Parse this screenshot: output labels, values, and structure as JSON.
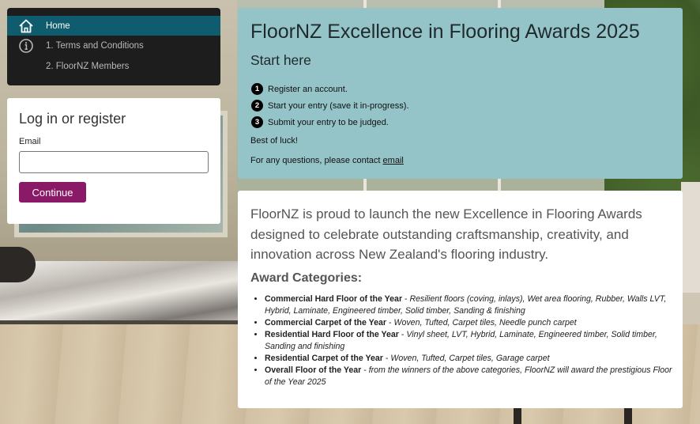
{
  "nav": {
    "items": [
      {
        "label": "Home",
        "icon": "home-icon",
        "active": true
      },
      {
        "label": "1. Terms and Conditions",
        "icon": "info-icon",
        "active": false
      },
      {
        "label": "2. FloorNZ Members",
        "icon": "",
        "active": false
      }
    ],
    "active_color": "#0f5c6e"
  },
  "login": {
    "title": "Log in or register",
    "email_label": "Email",
    "email_value": "",
    "continue_label": "Continue",
    "button_color": "#8a1a67"
  },
  "start": {
    "title": "FloorNZ Excellence in Flooring Awards 2025",
    "subtitle": "Start here",
    "steps": [
      {
        "number": "1",
        "text": "Register an account."
      },
      {
        "number": "2",
        "text": "Start your entry (save it in-progress)."
      },
      {
        "number": "3",
        "text": "Submit your entry to be judged."
      }
    ],
    "luck": "Best of luck!",
    "contact_prefix": "For any questions, please contact ",
    "contact_link": "email",
    "panel_color": "#95c4c8"
  },
  "info": {
    "intro": "FloorNZ is proud to launch the new Excellence in Flooring Awards designed to celebrate outstanding craftsmanship, creativity, and innovation across New Zealand's flooring industry.",
    "categories_title": "Award Categories:",
    "categories": [
      {
        "name": "Commercial Hard Floor of the Year",
        "desc": "Resilient floors (coving, inlays), Wet area flooring, Rubber, Walls LVT, Hybrid, Laminate, Engineered timber, Solid timber, Sanding & finishing"
      },
      {
        "name": "Commercial Carpet of the Year",
        "desc": "Woven, Tufted, Carpet tiles, Needle punch carpet"
      },
      {
        "name": "Residential Hard Floor of the Year",
        "desc": "Vinyl sheet, LVT, Hybrid, Laminate, Engineered timber, Solid timber, Sanding and finishing"
      },
      {
        "name": "Residential Carpet of the Year",
        "desc": "Woven, Tufted, Carpet tiles, Garage carpet"
      },
      {
        "name": "Overall Floor of the Year",
        "desc": "from the winners of the above categories, FloorNZ will award the prestigious Floor of the Year 2025"
      }
    ],
    "separator": " - "
  }
}
